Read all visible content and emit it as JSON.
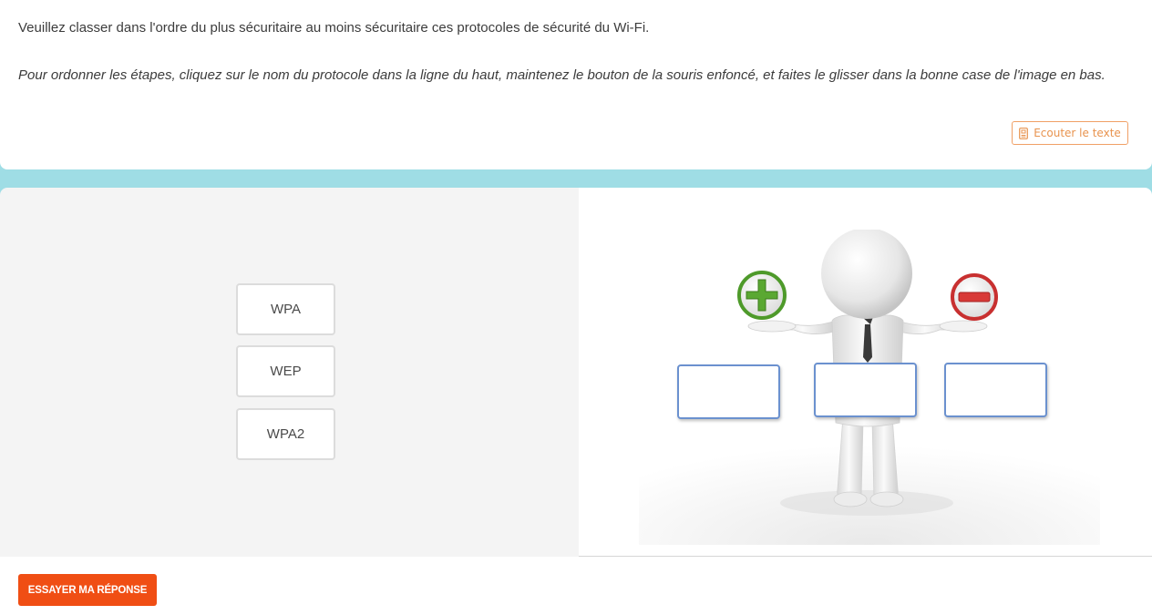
{
  "question": {
    "prompt": "Veuillez classer dans l'ordre du plus sécuritaire au moins sécuritaire ces protocoles de sécurité du Wi-Fi.",
    "instructions": "Pour ordonner les étapes, cliquez sur le nom du protocole dans la ligne du haut, maintenez le bouton de la souris enfoncé, et faites le glisser dans la bonne case de l'image en bas."
  },
  "listen_button": {
    "label": "Ecouter le texte",
    "icon": "document-audio-icon",
    "color": "#e8934e"
  },
  "draggables": [
    {
      "label": "WPA"
    },
    {
      "label": "WEP"
    },
    {
      "label": "WPA2"
    }
  ],
  "drop_targets": [
    {
      "name": "most-secure",
      "value": ""
    },
    {
      "name": "middle",
      "value": ""
    },
    {
      "name": "least-secure",
      "value": ""
    }
  ],
  "illustration": {
    "icons": [
      "plus-icon",
      "minus-icon"
    ],
    "plus_color": "#5aa832",
    "minus_color": "#d83a38"
  },
  "submit_button": {
    "label": "ESSAYER MA RÉPONSE",
    "color": "#f04e14"
  },
  "colors": {
    "band": "#9fdde5",
    "workspace": "#f4f4f4",
    "drop_border": "#6b91cf"
  }
}
